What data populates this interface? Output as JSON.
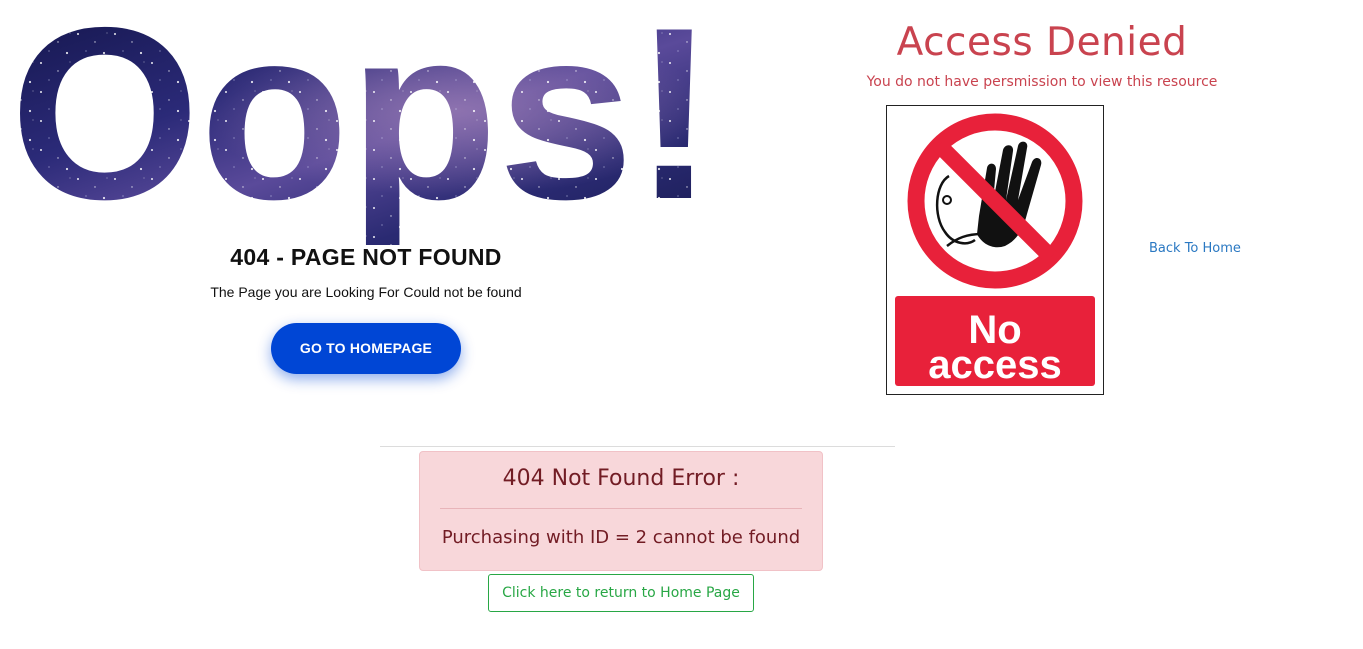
{
  "not_found": {
    "oops_text": "Oops!",
    "title": "404 - PAGE NOT FOUND",
    "subtitle": "The Page you are Looking For Could not be found",
    "button_label": "GO TO HOMEPAGE"
  },
  "access_denied": {
    "title": "Access Denied",
    "subtitle": "You do not have persmission to view this resource",
    "sign_text_line1": "No",
    "sign_text_line2": "access",
    "back_link": "Back To Home"
  },
  "error_alert": {
    "title": "404 Not Found Error :",
    "message": "Purchasing with ID = 2 cannot be found"
  },
  "return_button": {
    "label": "Click here to return to Home Page"
  },
  "colors": {
    "primary_button": "#0046d5",
    "denied_red": "#c9434f",
    "sign_red": "#e8213a",
    "alert_bg": "#f8d7da",
    "alert_text": "#721c24",
    "success_green": "#28a745",
    "link_blue": "#2a78c2"
  },
  "icons": {
    "sign": "no-entry-hand-icon"
  }
}
